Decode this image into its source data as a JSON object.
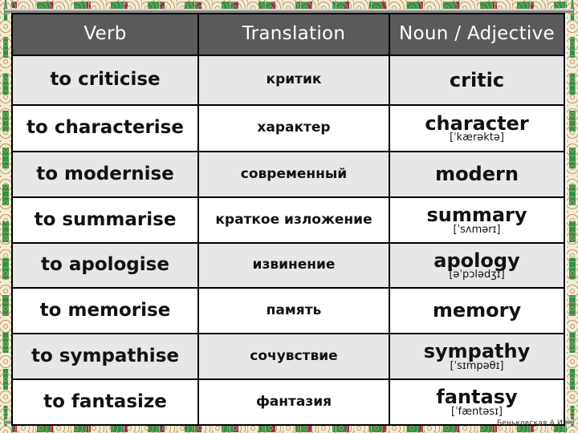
{
  "slide": {
    "credit": "Беньковская А.И.",
    "colors": {
      "header_bg": "#5a5a5a",
      "header_text": "#ffffff",
      "row_odd_bg": "#e7e7e7",
      "row_even_bg": "#ffffff",
      "border": "#000000",
      "frame_cream": "#f3ead7",
      "frame_green": "#1f8a3b",
      "frame_maroon": "#8c2348",
      "frame_gold": "#b99a58"
    }
  },
  "table": {
    "headers": [
      "Verb",
      "Translation",
      "Noun / Adjective"
    ],
    "rows": [
      {
        "verb": "to criticise",
        "translation": "критик",
        "noun": "critic",
        "ipa": ""
      },
      {
        "verb": "to characterise",
        "translation": "характер",
        "noun": "character",
        "ipa": "[ˈkærəktə]"
      },
      {
        "verb": "to modernise",
        "translation": "современный",
        "noun": "modern",
        "ipa": ""
      },
      {
        "verb": "to summarise",
        "translation": "краткое изложение",
        "noun": "summary",
        "ipa": "[ˈsʌmərɪ]"
      },
      {
        "verb": "to apologise",
        "translation": "извинение",
        "noun": "apology",
        "ipa": "[əˈpɔlədʒɪ]"
      },
      {
        "verb": "to memorise",
        "translation": "память",
        "noun": "memory",
        "ipa": ""
      },
      {
        "verb": "to sympathise",
        "translation": "сочувствие",
        "noun": "sympathy",
        "ipa": "[ˈsɪmpəθɪ]"
      },
      {
        "verb": "to fantasize",
        "translation": "фантазия",
        "noun": "fantasy",
        "ipa": "[ˈfæntəsɪ]"
      }
    ]
  }
}
